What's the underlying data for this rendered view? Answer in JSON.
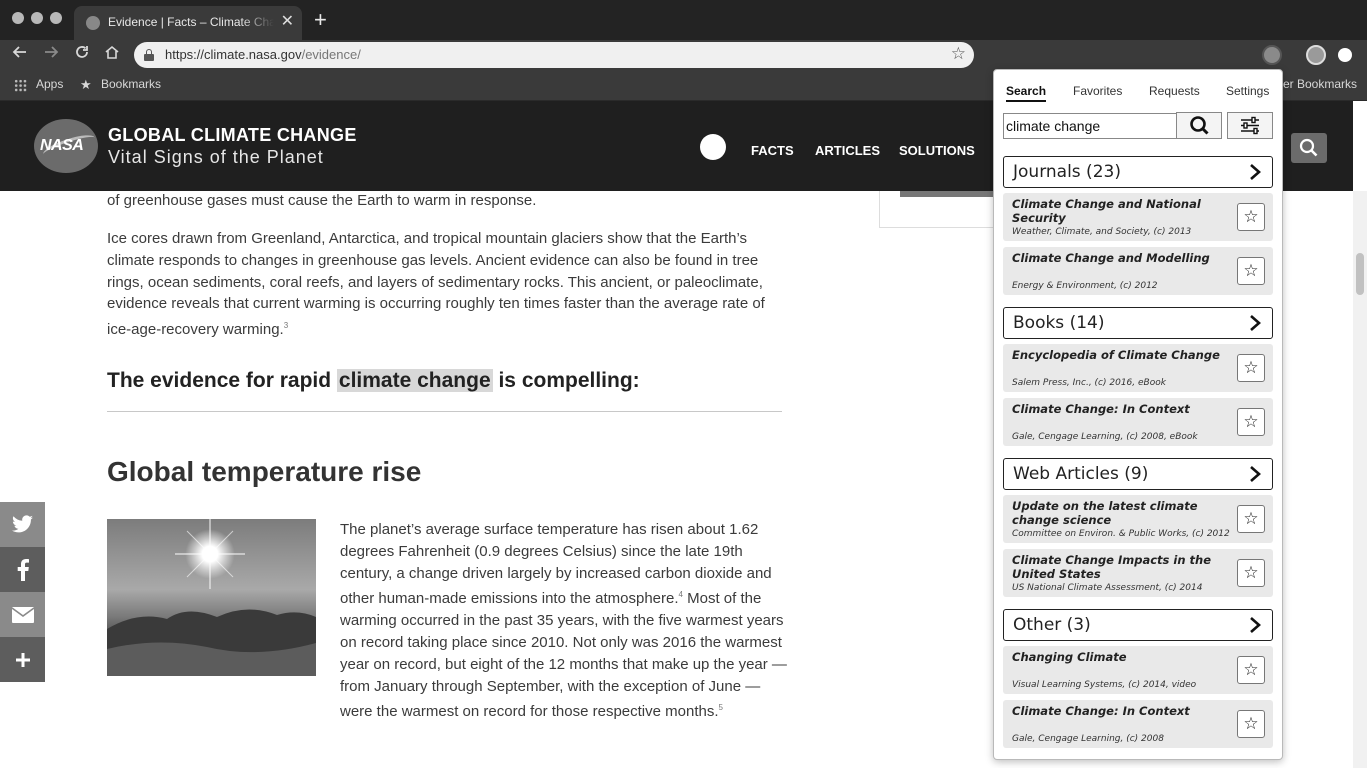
{
  "browser": {
    "tab_title": "Evidence | Facts – Climate Change: Vital Signs of the Planet",
    "tab_close": "✕",
    "new_tab": "+",
    "url_host": "https://climate.nasa.gov",
    "url_path": "/evidence/",
    "bookmarks": {
      "apps": "Apps",
      "bookmarks": "Bookmarks",
      "other": "er Bookmarks"
    }
  },
  "site": {
    "logo_text": "NASA",
    "title": "GLOBAL CLIMATE CHANGE",
    "subtitle": "Vital Signs of the Planet",
    "nav": [
      "FACTS",
      "ARTICLES",
      "SOLUTIONS"
    ]
  },
  "article": {
    "para0": "of greenhouse gases must cause the Earth to warm in response.",
    "para1": "Ice cores drawn from Greenland, Antarctica, and tropical mountain glaciers show that the Earth’s climate responds to changes in greenhouse gas levels. Ancient evidence can also be found in tree rings, ocean sediments, coral reefs, and layers of sedimentary rocks. This ancient, or paleoclimate, evidence reveals that current warming is occurring roughly ten times faster than the average rate of ice-age-recovery warming.",
    "para1_fn": "3",
    "heading_pre": "The evidence for rapid ",
    "heading_hl": "climate change",
    "heading_post": " is compelling:",
    "section_title": "Global temperature rise",
    "para2a": "The planet’s average surface temperature has risen about 1.62 degrees Fahrenheit (0.9 degrees Celsius) since the late 19th century, a change driven largely by increased carbon dioxide and other human-made emissions into the atmosphere.",
    "para2_fn1": "4",
    "para2b": " Most of the warming occurred in the past 35 years, with the five warmest years on record taking place since 2010. Not only was 2016 the warmest year on record, but eight of the 12 months that make up the year — from January through September, with the exception of June — were the warmest on record for those respective months.",
    "para2_fn2": "5"
  },
  "share": [
    "twitter-icon",
    "facebook-icon",
    "mail-icon",
    "plus-icon"
  ],
  "panel": {
    "tabs": [
      "Search",
      "Favorites",
      "Requests",
      "Settings"
    ],
    "search_value": "climate change",
    "sections": [
      {
        "title": "Journals (23)",
        "items": [
          {
            "title": "Climate Change and National Security",
            "meta": "Weather, Climate, and Society, (c) 2013"
          },
          {
            "title": "Climate Change and Modelling",
            "meta": "Energy & Environment, (c) 2012"
          }
        ]
      },
      {
        "title": "Books (14)",
        "items": [
          {
            "title": "Encyclopedia of Climate Change",
            "meta": "Salem Press, Inc., (c) 2016, eBook"
          },
          {
            "title": "Climate Change: In Context",
            "meta": "Gale, Cengage Learning, (c) 2008, eBook"
          }
        ]
      },
      {
        "title": "Web Articles (9)",
        "items": [
          {
            "title": "Update on the latest climate change science",
            "meta": "Committee on Environ. & Public Works, (c) 2012"
          },
          {
            "title": "Climate Change Impacts in the United States",
            "meta": "US National Climate Assessment, (c) 2014"
          }
        ]
      },
      {
        "title": "Other (3)",
        "items": [
          {
            "title": "Changing Climate",
            "meta": "Visual Learning Systems, (c) 2014, video"
          },
          {
            "title": "Climate Change: In Context",
            "meta": "Gale, Cengage Learning, (c) 2008"
          }
        ]
      }
    ]
  }
}
